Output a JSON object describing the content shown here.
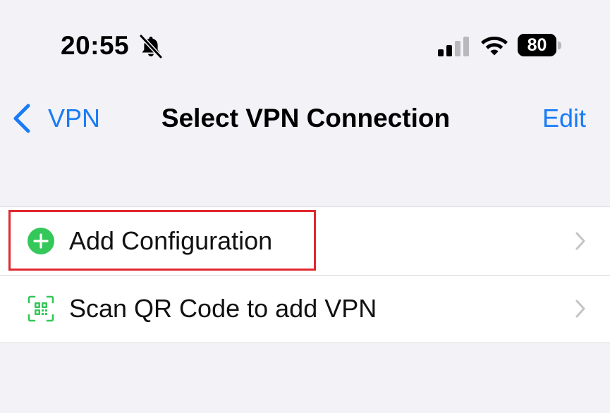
{
  "status_bar": {
    "time": "20:55",
    "battery_level": "80",
    "icons": [
      "bell-slash-icon",
      "cellular-signal-icon",
      "wifi-icon",
      "battery-icon"
    ]
  },
  "nav": {
    "back_label": "VPN",
    "title": "Select VPN Connection",
    "edit_label": "Edit"
  },
  "list": {
    "items": [
      {
        "label": "Add Configuration",
        "icon": "plus-circle-icon",
        "highlighted": true
      },
      {
        "label": "Scan QR Code to add VPN",
        "icon": "qr-code-scan-icon",
        "highlighted": false
      }
    ]
  },
  "colors": {
    "accent": "#1a7cf5",
    "add_green": "#34c759",
    "highlight_red": "#e0282e",
    "background": "#f2f2f7"
  }
}
